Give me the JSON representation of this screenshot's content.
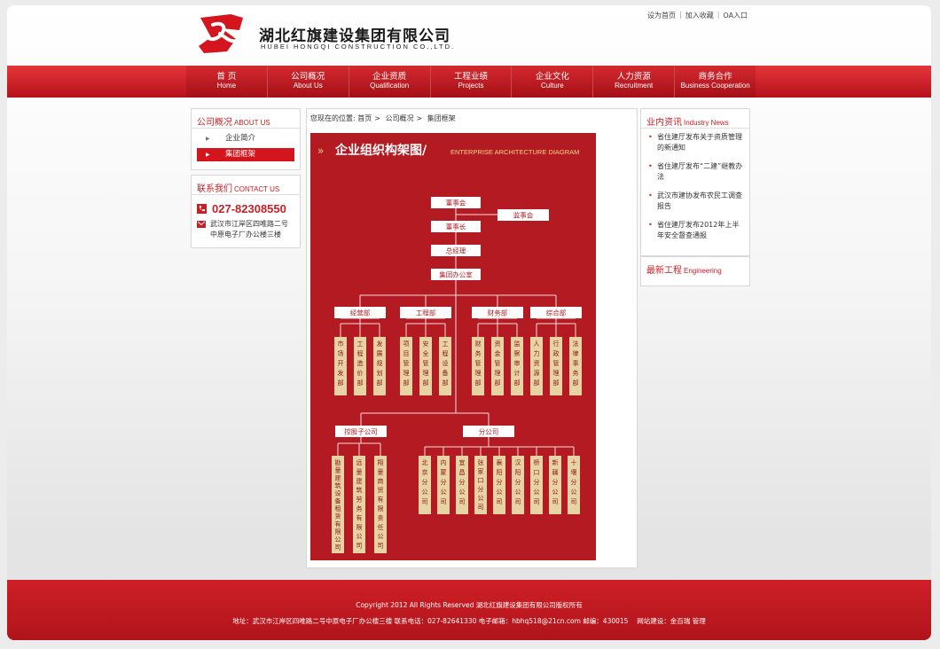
{
  "header": {
    "company_cn": "湖北红旗建设集团有限公司",
    "company_en": "HUBEI HONGQI CONSTRUCTION CO.,LTD.",
    "top_links": [
      "设为首页",
      "加入收藏",
      "OA入口"
    ]
  },
  "nav": [
    {
      "cn": "首 页",
      "en": "Home"
    },
    {
      "cn": "公司概况",
      "en": "About Us"
    },
    {
      "cn": "企业资质",
      "en": "Qualification"
    },
    {
      "cn": "工程业绩",
      "en": "Projects"
    },
    {
      "cn": "企业文化",
      "en": "Culture"
    },
    {
      "cn": "人力资源",
      "en": "Recruitment"
    },
    {
      "cn": "商务合作",
      "en": "Business Cooperation"
    }
  ],
  "sidebar": {
    "about": {
      "title_cn": "公司概况",
      "title_en": "ABOUT US",
      "items": [
        "企业简介",
        "集团框架"
      ]
    },
    "contact": {
      "title_cn": "联系我们",
      "title_en": "CONTACT US",
      "phone": "027-82308550",
      "address": "武汉市江岸区四唯路二号中原电子厂办公楼三楼"
    }
  },
  "breadcrumb": {
    "prefix": "您现在的位置:",
    "items": [
      "首页",
      "公司概况",
      "集团框架"
    ]
  },
  "org_chart": {
    "title_cn": "企业组织构架图/",
    "title_en": "ENTERPRISE ARCHITECTURE DIAGRAM",
    "board": "董事会",
    "supervisors": "监事会",
    "chairman": "董事长",
    "gm": "总经理",
    "office": "集团办公室",
    "departments": [
      {
        "name": "经营部",
        "subs": [
          "市场开发部",
          "工程造价部",
          "发展规划部"
        ]
      },
      {
        "name": "工程部",
        "subs": [
          "项目管理部",
          "安全管理部",
          "工程设备部"
        ]
      },
      {
        "name": "财务部",
        "subs": [
          "财务管理部",
          "资金管理部",
          "监察审计部"
        ]
      },
      {
        "name": "综合部",
        "subs": [
          "人力资源部",
          "行政管理部",
          "法律事务部"
        ]
      }
    ],
    "holding": {
      "name": "控股子公司",
      "subs": [
        "勘量建筑设备租赁有限公司",
        "远量建筑劳务有限公司",
        "翔量商贸有限责任公司"
      ]
    },
    "branches": {
      "name": "分公司",
      "subs": [
        "北京分公司",
        "内蒙分公司",
        "宜昌分公司",
        "张家口分公司",
        "襄阳分公司",
        "汉阳分公司",
        "桥口分公司",
        "新疆分公司",
        "十堰分公司"
      ]
    }
  },
  "right": {
    "news": {
      "title_cn": "业内资讯",
      "title_en": "Industry News",
      "items": [
        "省住建厅发布关于资质管理的新通知",
        "省住建厅发布“二建”继教办法",
        "武汉市建协发布农民工调查报告",
        "省住建厅发布2012年上半年安全督查通报"
      ]
    },
    "projects": {
      "title_cn": "最新工程",
      "title_en": "Engineering"
    }
  },
  "footer": {
    "copyright": "Copyright 2012 All Rights Reserved 湖北红旗建设集团有限公司版权所有",
    "contact": "地址：武汉市江岸区四唯路二号中原电子厂办公楼三楼 联系电话：027-82641330 电子邮箱：hbhq518@21cn.com 邮编：430015　 网站建设：金百瑞 管理"
  },
  "colors": {
    "brand_red": "#c81e25",
    "chart_bg": "#b41a22",
    "chart_box": "#e8d3a4"
  }
}
